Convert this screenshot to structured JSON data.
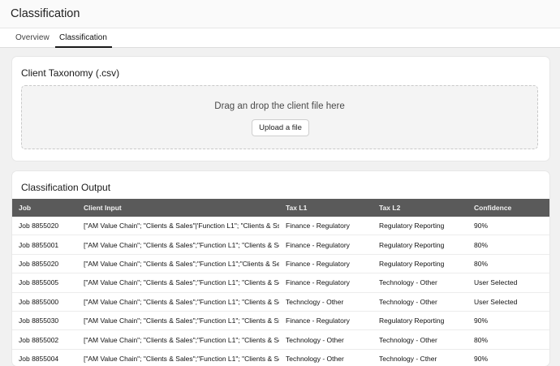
{
  "header": {
    "title": "Classification"
  },
  "tabs": [
    {
      "label": "Overview",
      "active": false
    },
    {
      "label": "Classification",
      "active": true
    }
  ],
  "taxonomy": {
    "title": "Client Taxonomy (.csv)",
    "drop_text": "Drag an drop the client file here",
    "upload_label": "Upload a file"
  },
  "output": {
    "title": "Classification Output",
    "columns": [
      "Job",
      "Client Input",
      "Tax L1",
      "Tax L2",
      "Confidence"
    ],
    "rows": [
      [
        "Job 8855020",
        "[\"AM Value Chain\"; \"Clients & Sales\"|'Function L1\"; \"Clients & Ss...",
        "Finance - Regulatory",
        "Regulatory Reporting",
        "90%"
      ],
      [
        "Job 8855001",
        "[\"AM Value Chain\"; \"Clients & Sales\";\"Function L1\"; \"Clients & Se...",
        "Finance - Regulatory",
        "Regulatory Reporting",
        "80%"
      ],
      [
        "Job 8855020",
        "[\"AM Value Chain\"; \"Clients & Sales\";\"Function L1\";\"Clients & Se...",
        "Finance - Regulatory",
        "Regulatory Reporting",
        "80%"
      ],
      [
        "Job 8855005",
        "[\"AM Value Chain\"; \"Clients & Sales\";\"Function L1\"; \"Clients & Se...",
        "Finance - Regulatory",
        "Technology - Other",
        "User Selected"
      ],
      [
        "Job 8855000",
        "[\"AM Value Chain\"; \"Clients & Sales\";\"Function L1\"; \"Clients & Se...",
        "Technclogy - Other",
        "Technology - Other",
        "User Selected"
      ],
      [
        "Job 8855030",
        "[\"AM Value Chain\"; \"Clients & Sales\";\"Function L1\"; \"Clients & Ss...",
        "Finance - Regulatory",
        "Regulatory Reporting",
        "90%"
      ],
      [
        "Job 8855002",
        "[\"AM Value Chain\"; \"Clients & Sales\";\"Function L1\"; \"Clients & Se...",
        "Technology - Other",
        "Technology - Other",
        "80%"
      ],
      [
        "Job 8855004",
        "[\"AM Value Chain\"; \"Clients & Sales\";\"Function L1\"; \"Clients & Se...",
        "Technology - Other",
        "Technology - Cther",
        "90%"
      ]
    ]
  }
}
